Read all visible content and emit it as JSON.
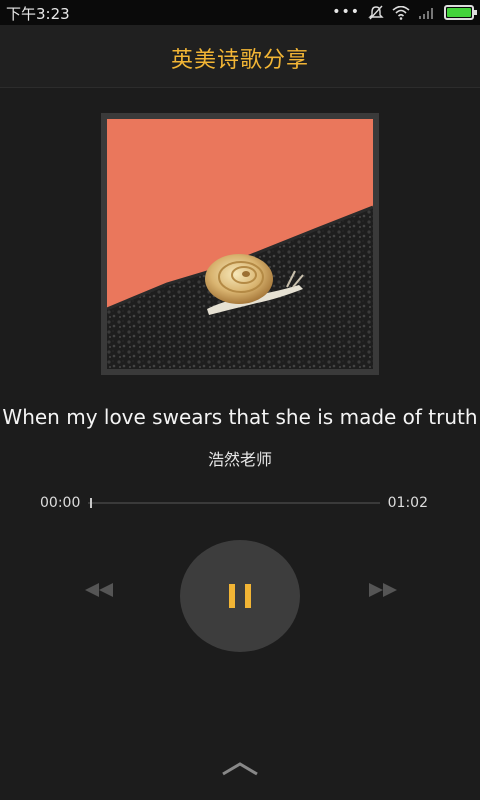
{
  "status_bar": {
    "time": "下午3:23",
    "icons": [
      "more-dots-icon",
      "mute-icon",
      "wifi-icon",
      "signal-icon",
      "battery-icon"
    ],
    "dots": "•••"
  },
  "header": {
    "title": "英美诗歌分享"
  },
  "track": {
    "title": "When my love swears that she is made of truth",
    "artist": "浩然老师",
    "elapsed": "00:00",
    "duration": "01:02",
    "progress": 0
  },
  "controls": {
    "prev_icon": "rewind-icon",
    "play_state_icon": "pause-icon",
    "next_icon": "fast-forward-icon",
    "expand_icon": "chevron-up-icon"
  },
  "colors": {
    "accent": "#f2b535",
    "background": "#1c1c1c",
    "cover_bg": "#ea775c"
  }
}
